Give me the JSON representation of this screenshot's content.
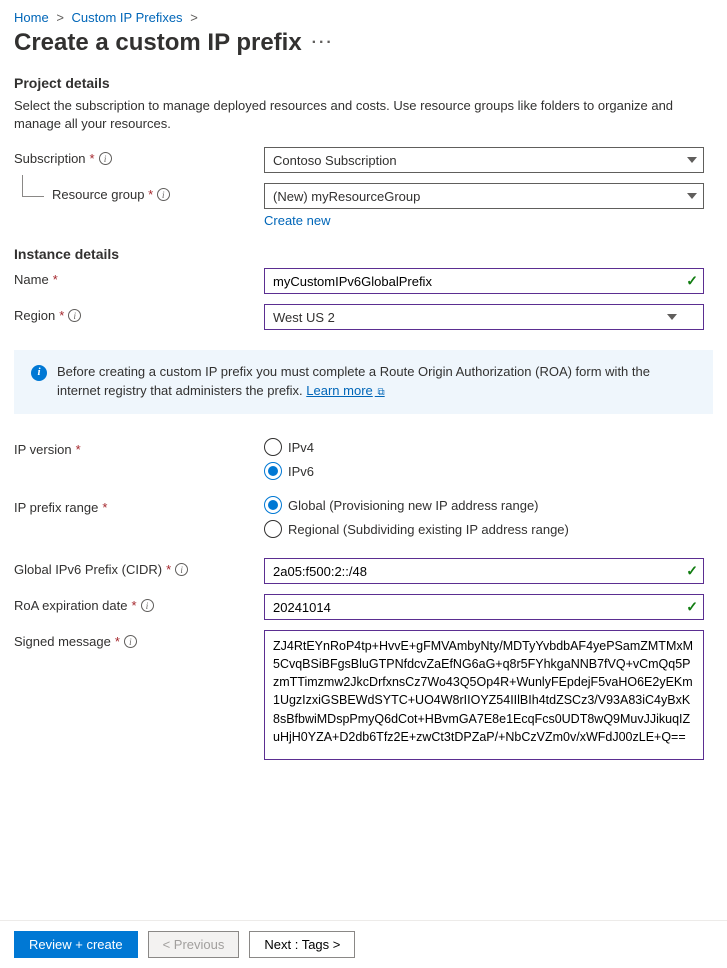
{
  "breadcrumb": {
    "home": "Home",
    "sep": ">",
    "prefixes": "Custom IP Prefixes"
  },
  "page_title": "Create a custom IP prefix",
  "project_details": {
    "title": "Project details",
    "desc": "Select the subscription to manage deployed resources and costs. Use resource groups like folders to organize and manage all your resources.",
    "subscription_label": "Subscription",
    "subscription_value": "Contoso Subscription",
    "resource_group_label": "Resource group",
    "resource_group_value": "(New) myResourceGroup",
    "create_new": "Create new"
  },
  "instance_details": {
    "title": "Instance details",
    "name_label": "Name",
    "name_value": "myCustomIPv6GlobalPrefix",
    "region_label": "Region",
    "region_value": "West US 2"
  },
  "info_banner": {
    "text": "Before creating a custom IP prefix you must complete a Route Origin Authorization (ROA) form with the internet registry that administers the prefix. ",
    "learn_more": "Learn more"
  },
  "ip_version": {
    "label": "IP version",
    "opt_v4": "IPv4",
    "opt_v6": "IPv6",
    "selected": "IPv6"
  },
  "ip_prefix_range": {
    "label": "IP prefix range",
    "opt_global": "Global (Provisioning new IP address range)",
    "opt_regional": "Regional (Subdividing existing IP address range)",
    "selected": "Global"
  },
  "cidr": {
    "label": "Global IPv6 Prefix (CIDR)",
    "value": "2a05:f500:2::/48"
  },
  "roa_exp": {
    "label": "RoA expiration date",
    "value": "20241014"
  },
  "signed_msg": {
    "label": "Signed message",
    "value": "ZJ4RtEYnRoP4tp+HvvE+gFMVAmbyNty/MDTyYvbdbAF4yePSamZMTMxM5CvqBSiBFgsBluGTPNfdcvZaEfNG6aG+q8r5FYhkgaNNB7fVQ+vCmQq5PzmTTimzmw2JkcDrfxnsCz7Wo43Q5Op4R+WunlyFEpdejF5vaHO6E2yEKm1UgzIzxiGSBEWdSYTC+UO4W8rIIOYZ54IIlBIh4tdZSCz3/V93A83iC4yBxK8sBfbwiMDspPmyQ6dCot+HBvmGA7E8e1EcqFcs0UDT8wQ9MuvJJikuqIZuHjH0YZA+D2db6Tfz2E+zwCt3tDPZaP/+NbCzVZm0v/xWFdJ00zLE+Q=="
  },
  "footer": {
    "review": "Review + create",
    "prev": "< Previous",
    "next": "Next : Tags >"
  }
}
